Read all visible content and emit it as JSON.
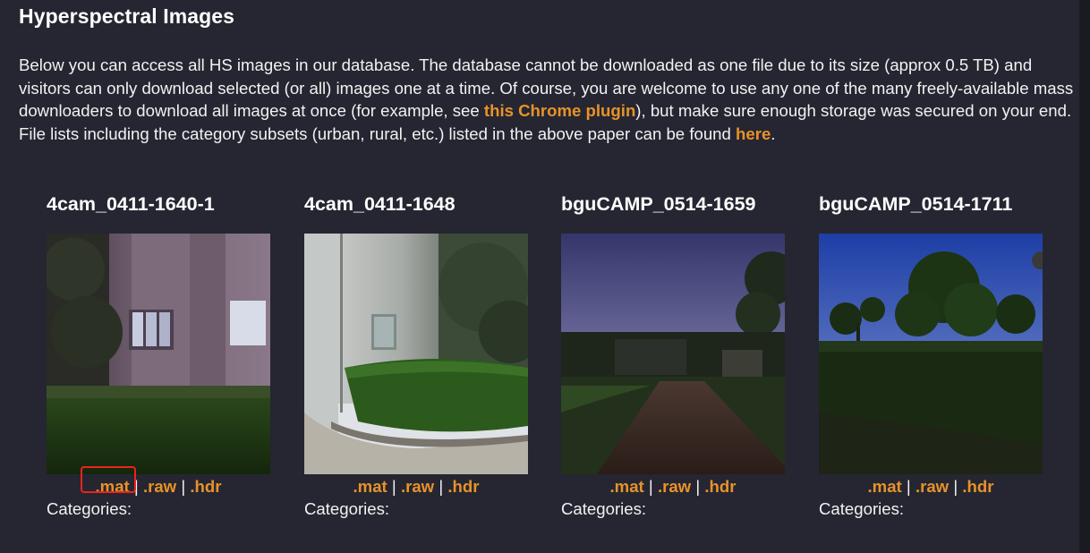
{
  "heading": "Hyperspectral Images",
  "intro": {
    "part1": "Below you can access all HS images in our database. The database cannot be downloaded as one file due to its size (approx 0.5 TB) and visitors can only download selected (or all) images one at a time. Of course, you are welcome to use any one of the many freely-available mass downloaders to download all images at once (for example, see ",
    "link1": "this Chrome plugin",
    "part2": "), but make sure enough storage was secured on your end. File lists including the category subsets (urban, rural, etc.) listed in the above paper can be found ",
    "link2": "here",
    "part3": "."
  },
  "separator": "|",
  "categories_label": "Categories:",
  "items": [
    {
      "title": "4cam_0411-1640-1",
      "mat": ".mat",
      "raw": ".raw",
      "hdr": ".hdr"
    },
    {
      "title": "4cam_0411-1648",
      "mat": ".mat",
      "raw": ".raw",
      "hdr": ".hdr"
    },
    {
      "title": "bguCAMP_0514-1659",
      "mat": ".mat",
      "raw": ".raw",
      "hdr": ".hdr"
    },
    {
      "title": "bguCAMP_0514-1711",
      "mat": ".mat",
      "raw": ".raw",
      "hdr": ".hdr"
    }
  ],
  "colors": {
    "link": "#e8922a",
    "background": "#252631",
    "annotation": "#e8241c"
  }
}
